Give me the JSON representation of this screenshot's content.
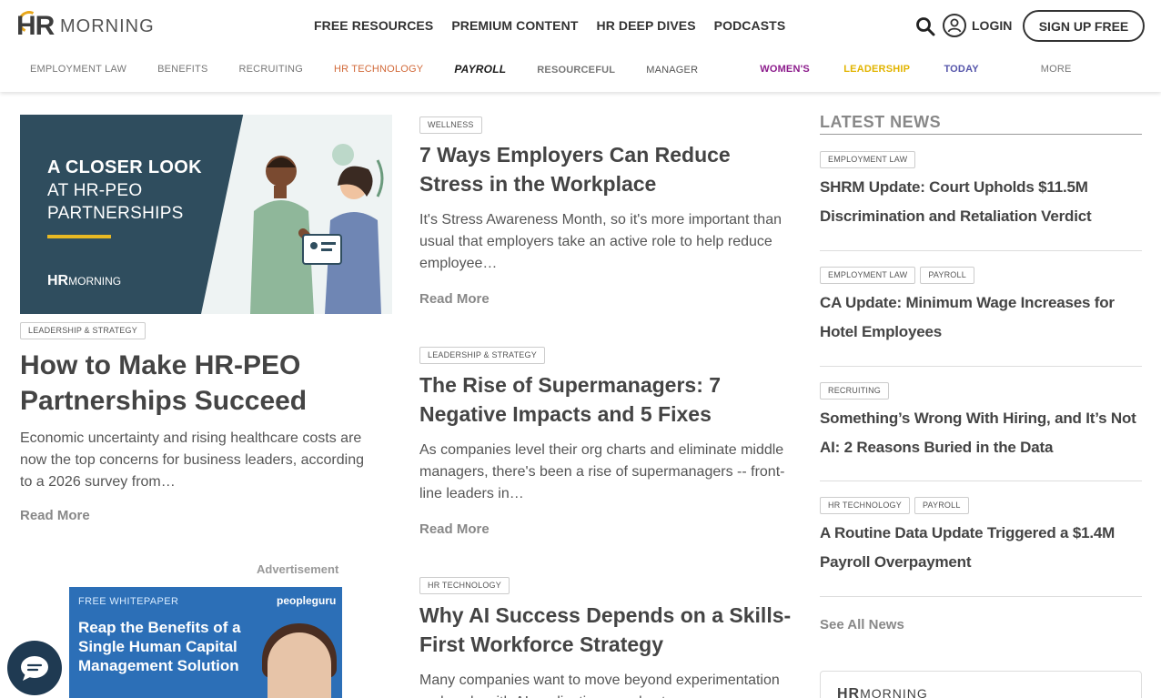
{
  "header": {
    "logo": {
      "mark": "HR",
      "word": "MORNING"
    },
    "nav": [
      "FREE RESOURCES",
      "PREMIUM CONTENT",
      "HR DEEP DIVES",
      "PODCASTS"
    ],
    "login_label": "LOGIN",
    "signup_label": "SIGN UP FREE",
    "subnav": {
      "employment_law": "EMPLOYMENT LAW",
      "benefits": "BENEFITS",
      "recruiting": "RECRUITING",
      "hr_technology": "HR TECHNOLOGY",
      "payroll": "PAYROLL",
      "resourceful": "resourceful",
      "manager": "manager",
      "womens": "WOMEN'S",
      "leadership": "LEADERSHIP",
      "today": "TODAY",
      "more": "MORE"
    }
  },
  "featured": {
    "image": {
      "line1": "A CLOSER LOOK",
      "line2": "AT HR-PEO",
      "line3": "PARTNERSHIPS",
      "logo_mark": "HR",
      "logo_word": "MORNING"
    },
    "tag": "LEADERSHIP & STRATEGY",
    "title": "How to Make HR-PEO Partnerships Succeed",
    "excerpt": "Economic uncertainty and rising healthcare costs are now the top concerns for business leaders, according to a 2026 survey from…",
    "read_more": "Read More"
  },
  "advertisement": {
    "label": "Advertisement",
    "kicker": "FREE WHITEPAPER",
    "brand": "peopleguru",
    "headline": "Reap the Benefits of a Single Human Capital Management Solution"
  },
  "middle": [
    {
      "tag": "WELLNESS",
      "title": "7 Ways Employers Can Reduce Stress in the Workplace",
      "excerpt": "It's Stress Awareness Month, so it's more important than usual that employers take an active role to help reduce employee…",
      "read_more": "Read More"
    },
    {
      "tag": "LEADERSHIP & STRATEGY",
      "title": "The Rise of Supermanagers: 7 Negative Impacts and 5 Fixes",
      "excerpt": "As companies level their org charts and eliminate middle managers, there's been a rise of supermanagers -- front-line leaders in…",
      "read_more": "Read More"
    },
    {
      "tag": "HR TECHNOLOGY",
      "title": "Why AI Success Depends on a Skills-First Workforce Strategy",
      "excerpt": "Many companies want to move beyond experimentation and scale with AI applications, and yet…"
    }
  ],
  "latest": {
    "heading": "LATEST NEWS",
    "items": [
      {
        "tags": [
          "EMPLOYMENT LAW"
        ],
        "title": "SHRM Update: Court Upholds $11.5M Discrimination and Retaliation Verdict"
      },
      {
        "tags": [
          "EMPLOYMENT LAW",
          "PAYROLL"
        ],
        "title": "CA Update: Minimum Wage Increases for Hotel Employees"
      },
      {
        "tags": [
          "RECRUITING"
        ],
        "title": "Something’s Wrong With Hiring, and It’s Not AI: 2 Reasons Buried in the Data"
      },
      {
        "tags": [
          "HR TECHNOLOGY",
          "PAYROLL"
        ],
        "title": "A Routine Data Update Triggered a $1.4M Payroll Overpayment"
      }
    ],
    "see_all": "See All News",
    "promo_logo_mark": "HR",
    "promo_logo_word": "MORNING"
  }
}
